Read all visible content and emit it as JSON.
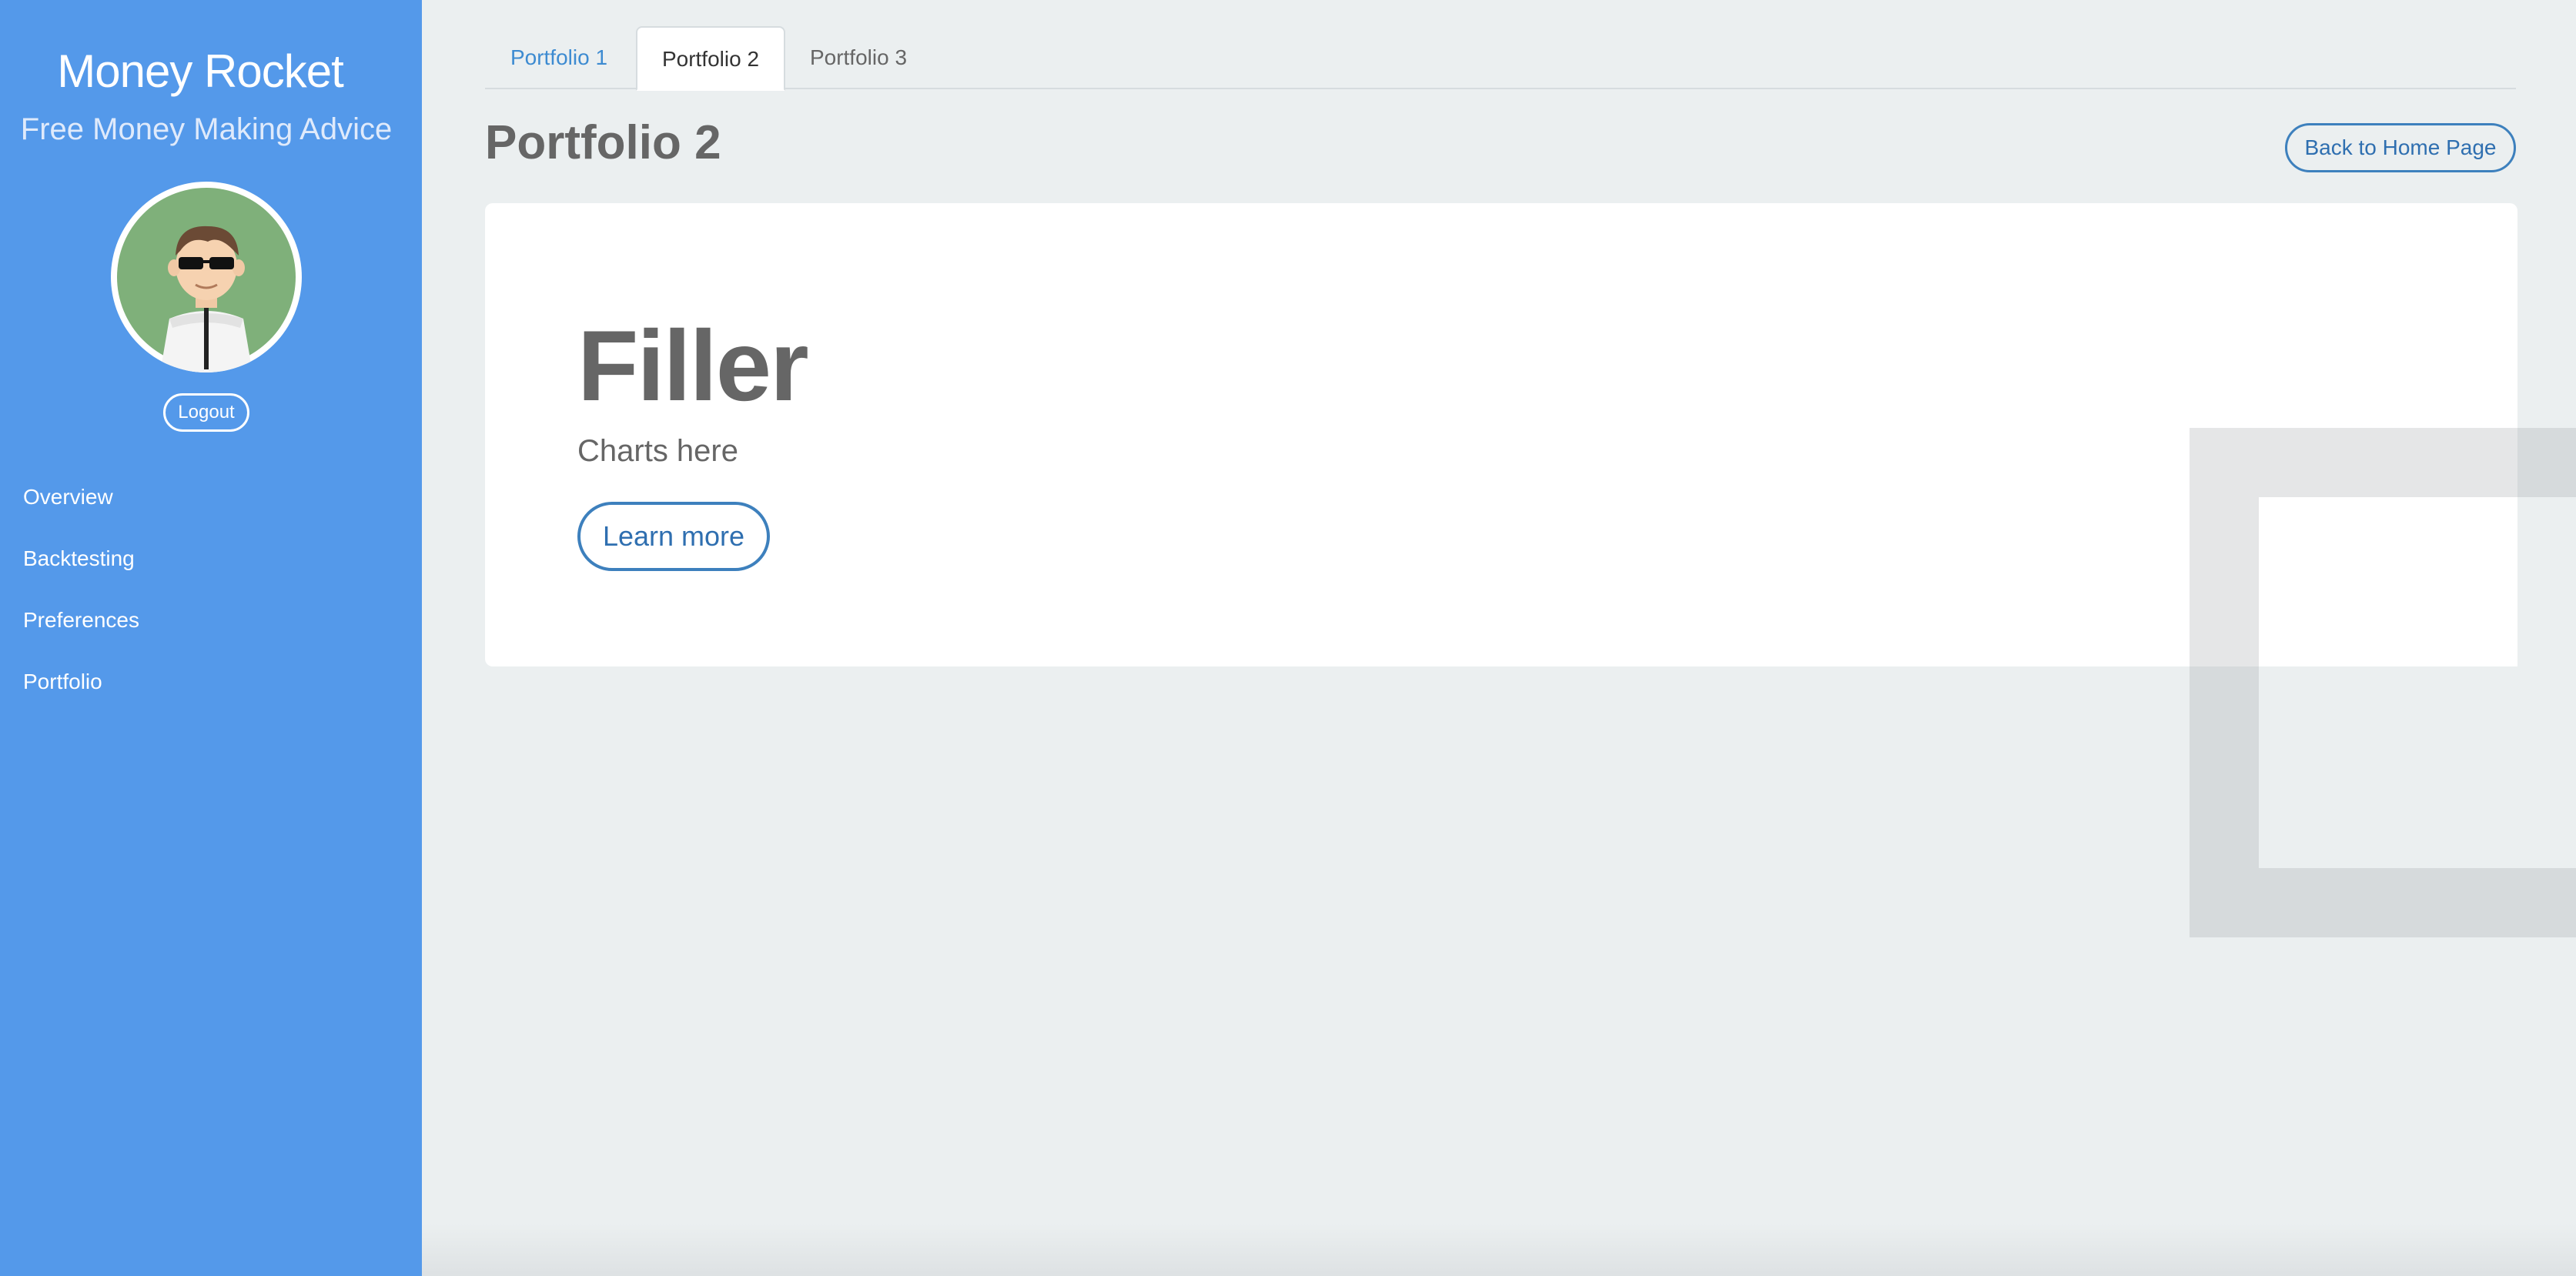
{
  "sidebar": {
    "brand_title": "Money Rocket",
    "brand_subtitle": "Free Money Making Advice",
    "logout_label": "Logout",
    "nav_items": [
      {
        "label": "Overview"
      },
      {
        "label": "Backtesting"
      },
      {
        "label": "Preferences"
      },
      {
        "label": "Portfolio"
      }
    ]
  },
  "tabs": [
    {
      "label": "Portfolio 1",
      "active": false
    },
    {
      "label": "Portfolio 2",
      "active": true
    },
    {
      "label": "Portfolio 3",
      "active": false
    }
  ],
  "page": {
    "title": "Portfolio 2",
    "back_button_label": "Back to Home Page"
  },
  "card": {
    "heading": "Filler",
    "text": "Charts here",
    "button_label": "Learn more"
  },
  "colors": {
    "sidebar": "#5499ea",
    "background": "#ebeff0",
    "accent": "#3d80bd"
  }
}
